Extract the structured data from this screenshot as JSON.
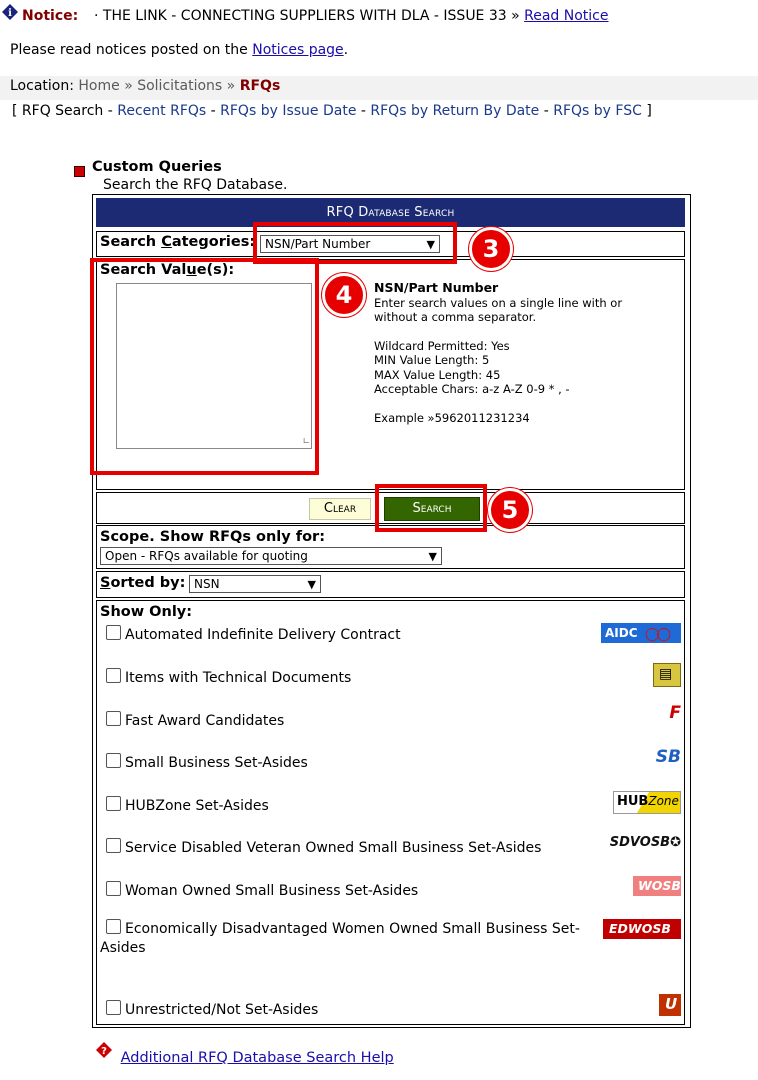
{
  "notice": {
    "label": "Notice:",
    "text": "· THE LINK - CONNECTING SUPPLIERS WITH DLA - ISSUE 33 »",
    "link": "Read Notice"
  },
  "please": {
    "prefix": "Please read notices posted on the ",
    "link": "Notices page",
    "suffix": "."
  },
  "location": {
    "label": "Location:",
    "home": "Home",
    "sep": "»",
    "solicitations": "Solicitations",
    "current": "RFQs"
  },
  "subnav": {
    "open": "[",
    "rfq_search": "RFQ Search",
    "recent": "Recent RFQs",
    "by_issue": "RFQs by Issue Date",
    "by_return": "RFQs by Return By Date",
    "by_fsc": "RFQs by FSC",
    "dash": "-",
    "close": "]"
  },
  "custom_queries": {
    "title": "Custom Queries",
    "subtitle": "Search the RFQ Database."
  },
  "search_panel": {
    "header": "RFQ Database Search",
    "categories_label_pre": "Search ",
    "categories_label_u": "C",
    "categories_label_post": "ategories:",
    "category_selected": "NSN/Part Number",
    "values_label_pre": "Search Val",
    "values_label_u": "u",
    "values_label_post": "e(s):",
    "info": {
      "title": "NSN/Part Number",
      "line1": "Enter search values on a single line with or",
      "line2": "without a comma separator.",
      "wildcard": "Wildcard Permitted: Yes",
      "min": "MIN Value Length: 5",
      "max": "MAX Value Length: 45",
      "chars": "Acceptable Chars: a-z A-Z 0-9 * , -",
      "example": "Example »5962011231234"
    },
    "clear_label": "Clear",
    "search_label": "Search",
    "scope_label": "Scope. Show RFQs only for:",
    "scope_selected": "Open - RFQs available for quoting",
    "sorted_label_u": "S",
    "sorted_label_post": "orted by:",
    "sorted_selected": "NSN",
    "show_only_label": "Show Only:",
    "options": [
      {
        "label": "Automated Indefinite Delivery Contract"
      },
      {
        "label": "Items with Technical Documents"
      },
      {
        "label": "Fast Award Candidates"
      },
      {
        "label": "Small Business Set-Asides"
      },
      {
        "label": "HUBZone Set-Asides"
      },
      {
        "label": "Service Disabled Veteran Owned Small Business Set-Asides"
      },
      {
        "label": "Woman Owned Small Business Set-Asides"
      },
      {
        "label": "Economically Disadvantaged Women Owned Small Business Set-"
      },
      {
        "label": "Unrestricted/Not Set-Asides"
      }
    ],
    "option8_cont": "Asides",
    "logos": {
      "aidc": "AIDC",
      "f": "F",
      "sb": "SB",
      "hub": "HUB",
      "hub_zone": "Zone",
      "sdvosb": "SDVOSB",
      "wosb": "WOSB",
      "edwosb": "EDWOSB",
      "u": "U"
    }
  },
  "callouts": {
    "three": "3",
    "four": "4",
    "five": "5"
  },
  "help": {
    "link": "Additional RFQ Database Search Help"
  },
  "colors": {
    "header_bg": "#1c2a73",
    "search_btn": "#336600",
    "clear_btn": "#fdfdd8",
    "callout_red": "#e60000",
    "notice_red": "#800000"
  }
}
